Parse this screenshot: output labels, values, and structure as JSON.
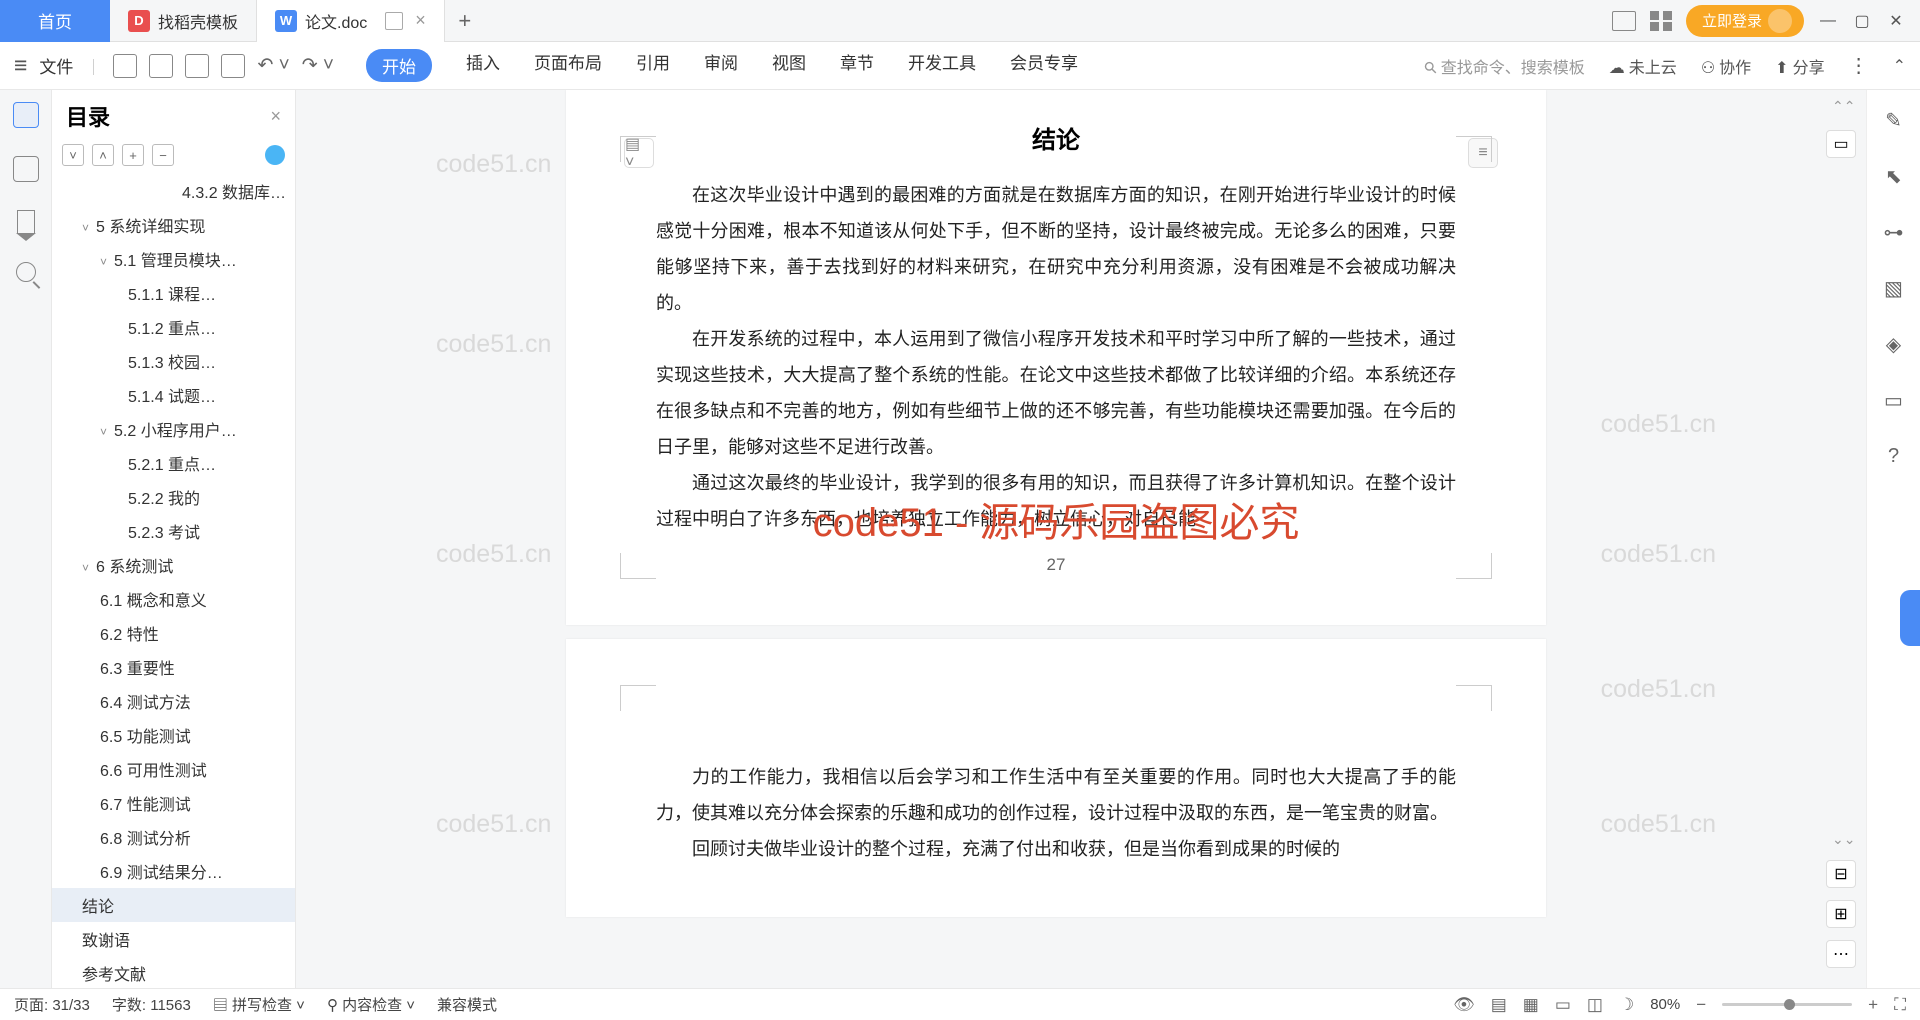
{
  "titlebar": {
    "home": "首页",
    "tab1": "找稻壳模板",
    "tab2": "论文.doc",
    "login": "立即登录"
  },
  "ribbon": {
    "file": "文件",
    "tabs": [
      "开始",
      "插入",
      "页面布局",
      "引用",
      "审阅",
      "视图",
      "章节",
      "开发工具",
      "会员专享"
    ],
    "search_placeholder": "查找命令、搜索模板",
    "cloud": "未上云",
    "collab": "协作",
    "share": "分享"
  },
  "outline": {
    "title": "目录",
    "items": [
      {
        "t": "4.3.2 数据库…",
        "lvl": "lvl0o"
      },
      {
        "t": "5 系统详细实现",
        "lvl": "lvl1",
        "chev": "˅"
      },
      {
        "t": "5.1 管理员模块…",
        "lvl": "lvl2",
        "chev": "˅"
      },
      {
        "t": "5.1.1 课程…",
        "lvl": "lvl3"
      },
      {
        "t": "5.1.2 重点…",
        "lvl": "lvl3"
      },
      {
        "t": "5.1.3 校园…",
        "lvl": "lvl3"
      },
      {
        "t": "5.1.4 试题…",
        "lvl": "lvl3"
      },
      {
        "t": "5.2 小程序用户…",
        "lvl": "lvl2",
        "chev": "˅"
      },
      {
        "t": "5.2.1 重点…",
        "lvl": "lvl3"
      },
      {
        "t": "5.2.2 我的",
        "lvl": "lvl3"
      },
      {
        "t": "5.2.3 考试",
        "lvl": "lvl3"
      },
      {
        "t": "6 系统测试",
        "lvl": "lvl1",
        "chev": "˅"
      },
      {
        "t": "6.1 概念和意义",
        "lvl": "lvl2"
      },
      {
        "t": "6.2 特性",
        "lvl": "lvl2"
      },
      {
        "t": "6.3 重要性",
        "lvl": "lvl2"
      },
      {
        "t": "6.4 测试方法",
        "lvl": "lvl2"
      },
      {
        "t": "6.5 功能测试",
        "lvl": "lvl2"
      },
      {
        "t": "6.6 可用性测试",
        "lvl": "lvl2"
      },
      {
        "t": "6.7 性能测试",
        "lvl": "lvl2"
      },
      {
        "t": "6.8 测试分析",
        "lvl": "lvl2"
      },
      {
        "t": "6.9 测试结果分…",
        "lvl": "lvl2"
      },
      {
        "t": "结论",
        "lvl": "lvl1",
        "sel": true
      },
      {
        "t": "致谢语",
        "lvl": "lvl1"
      },
      {
        "t": "参考文献",
        "lvl": "lvl1"
      }
    ]
  },
  "doc": {
    "heading": "结论",
    "p1": "在这次毕业设计中遇到的最困难的方面就是在数据库方面的知识，在刚开始进行毕业设计的时候感觉十分困难，根本不知道该从何处下手，但不断的坚持，设计最终被完成。无论多么的困难，只要能够坚持下来，善于去找到好的材料来研究，在研究中充分利用资源，没有困难是不会被成功解决的。",
    "p2": "在开发系统的过程中，本人运用到了微信小程序开发技术和平时学习中所了解的一些技术，通过实现这些技术，大大提高了整个系统的性能。在论文中这些技术都做了比较详细的介绍。本系统还存在很多缺点和不完善的地方，例如有些细节上做的还不够完善，有些功能模块还需要加强。在今后的日子里，能够对这些不足进行改善。",
    "p3": "通过这次最终的毕业设计，我学到的很多有用的知识，而且获得了许多计算机知识。在整个设计过程中明白了许多东西，也培养独立工作能力，树立信心，对自己能",
    "page_num": "27",
    "p4": "力的工作能力，我相信以后会学习和工作生活中有至关重要的作用。同时也大大提高了手的能力，使其难以充分体会探索的乐趣和成功的创作过程，设计过程中汲取的东西，是一笔宝贵的财富。",
    "p5": "回顾讨夫做毕业设计的整个过程，充满了付出和收获，但是当你看到成果的时候的",
    "overlay": "code51 - 源码乐园盗图必究",
    "wm": "code51.cn"
  },
  "status": {
    "page": "页面: 31/33",
    "words": "字数: 11563",
    "spell": "拼写检查",
    "content": "内容检查",
    "compat": "兼容模式",
    "zoom": "80%"
  }
}
